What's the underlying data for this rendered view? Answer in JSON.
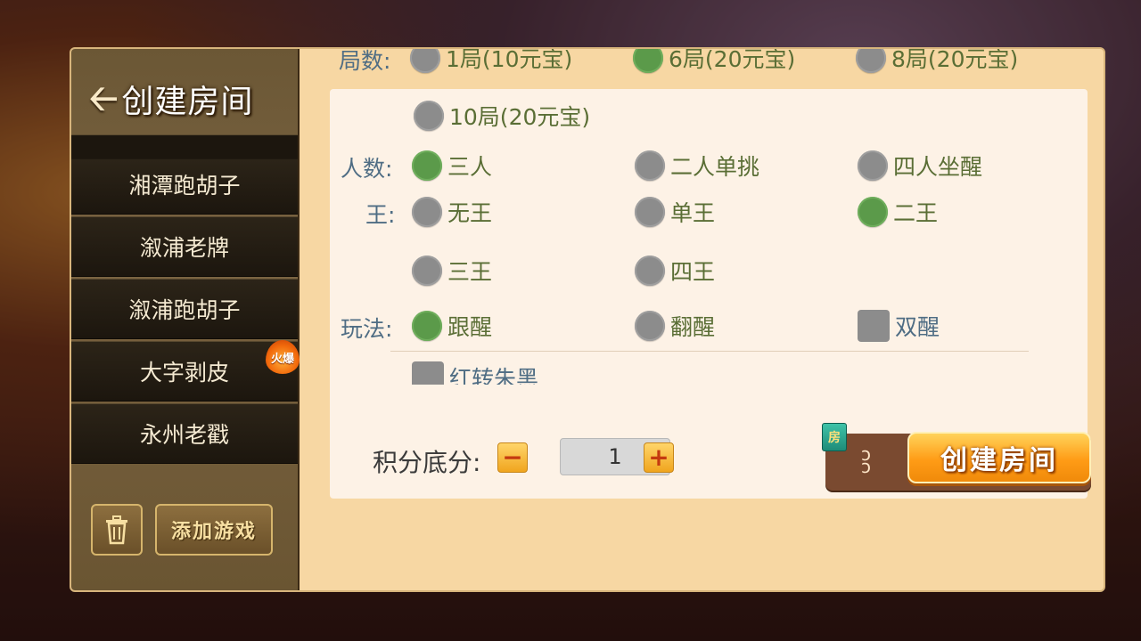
{
  "sidebar": {
    "back_label": "创建房间",
    "partial_item": "湘潭跑胡子",
    "games": [
      {
        "label": "湘潭跑胡子",
        "badge": ""
      },
      {
        "label": "溆浦老牌",
        "badge": ""
      },
      {
        "label": "溆浦跑胡子",
        "badge": ""
      },
      {
        "label": "大字剥皮",
        "badge": "火爆"
      },
      {
        "label": "永州老戳",
        "badge": ""
      }
    ],
    "add_game_label": "添加游戏"
  },
  "rounds": {
    "label": "局数:",
    "options": [
      {
        "label": "1局(10元宝)",
        "selected": false
      },
      {
        "label": "6局(20元宝)",
        "selected": true
      },
      {
        "label": "8局(20元宝)",
        "selected": false
      },
      {
        "label": "10局(20元宝)",
        "selected": false
      }
    ]
  },
  "players": {
    "label": "人数:",
    "options": [
      {
        "label": "三人",
        "selected": true
      },
      {
        "label": "二人单挑",
        "selected": false
      },
      {
        "label": "四人坐醒",
        "selected": false
      }
    ]
  },
  "kings": {
    "label": "王:",
    "options": [
      {
        "label": "无王",
        "selected": false
      },
      {
        "label": "单王",
        "selected": false
      },
      {
        "label": "二王",
        "selected": true
      },
      {
        "label": "三王",
        "selected": false
      },
      {
        "label": "四王",
        "selected": false
      }
    ]
  },
  "play_mode": {
    "label": "玩法:",
    "options": [
      {
        "label": "跟醒",
        "selected": true
      },
      {
        "label": "翻醒",
        "selected": false
      }
    ],
    "checkboxes": [
      {
        "label": "双醒",
        "checked": false
      },
      {
        "label": "红转朱黑",
        "checked": false
      }
    ]
  },
  "score": {
    "label": "积分底分:",
    "minus": "−",
    "plus": "+",
    "value": "1"
  },
  "create": {
    "card_icon_label": "房",
    "card_count": "ɔ\nɔ",
    "button_label": "创建房间"
  },
  "colors": {
    "selected_radio": "#5b9a4a",
    "unselected_radio": "#8c8c8c",
    "option_text": "#5a6e35",
    "row_label_text": "#4f6d84",
    "create_button": "#ff9c16"
  }
}
